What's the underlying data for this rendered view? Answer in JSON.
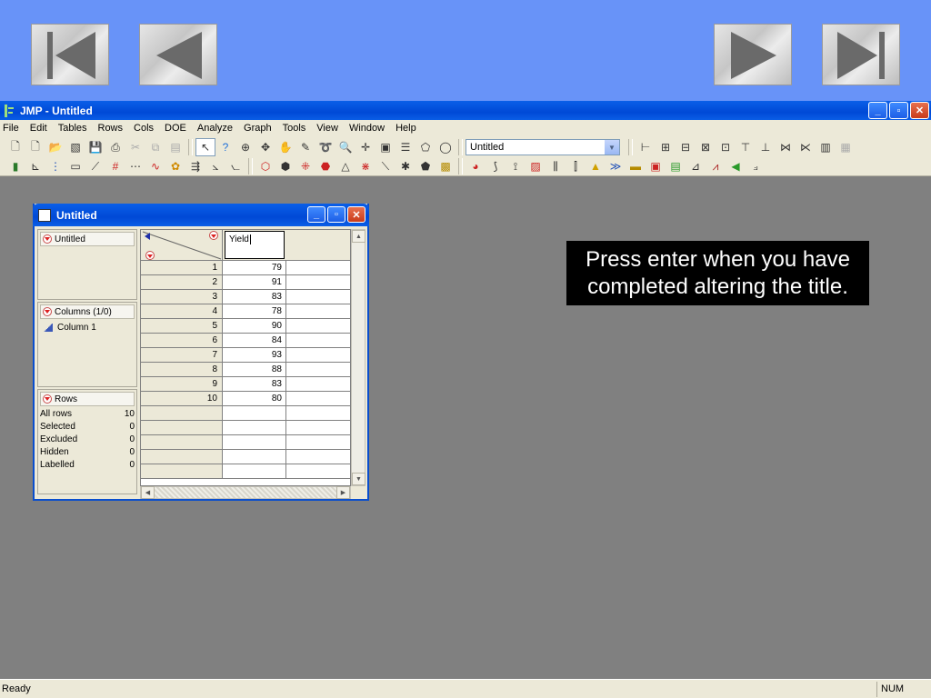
{
  "slide_nav": {
    "first_icon": "first-slide-icon",
    "prev_icon": "previous-slide-icon",
    "next_icon": "next-slide-icon",
    "last_icon": "last-slide-icon"
  },
  "window": {
    "title": "JMP - Untitled",
    "min_glyph": "_",
    "max_glyph": "▫",
    "close_glyph": "✕"
  },
  "menu": [
    "File",
    "Edit",
    "Tables",
    "Rows",
    "Cols",
    "DOE",
    "Analyze",
    "Graph",
    "Tools",
    "View",
    "Window",
    "Help"
  ],
  "toolbar": {
    "dropdown_value": "Untitled",
    "dropdown_arrow": "▼"
  },
  "data_table": {
    "title": "Untitled",
    "table_panel_label": "Untitled",
    "columns_panel_label": "Columns (1/0)",
    "columns": [
      "Column 1"
    ],
    "rows_panel_label": "Rows",
    "row_stats": [
      {
        "label": "All rows",
        "value": "10"
      },
      {
        "label": "Selected",
        "value": "0"
      },
      {
        "label": "Excluded",
        "value": "0"
      },
      {
        "label": "Hidden",
        "value": "0"
      },
      {
        "label": "Labelled",
        "value": "0"
      }
    ],
    "column_header_edit": "Yield",
    "rows": [
      {
        "n": "1",
        "v": "79"
      },
      {
        "n": "2",
        "v": "91"
      },
      {
        "n": "3",
        "v": "83"
      },
      {
        "n": "4",
        "v": "78"
      },
      {
        "n": "5",
        "v": "90"
      },
      {
        "n": "6",
        "v": "84"
      },
      {
        "n": "7",
        "v": "93"
      },
      {
        "n": "8",
        "v": "88"
      },
      {
        "n": "9",
        "v": "83"
      },
      {
        "n": "10",
        "v": "80"
      }
    ]
  },
  "callout": {
    "line1": "Press enter when you have",
    "line2": "completed altering the title."
  },
  "status": {
    "text": "Ready",
    "num": "NUM"
  }
}
